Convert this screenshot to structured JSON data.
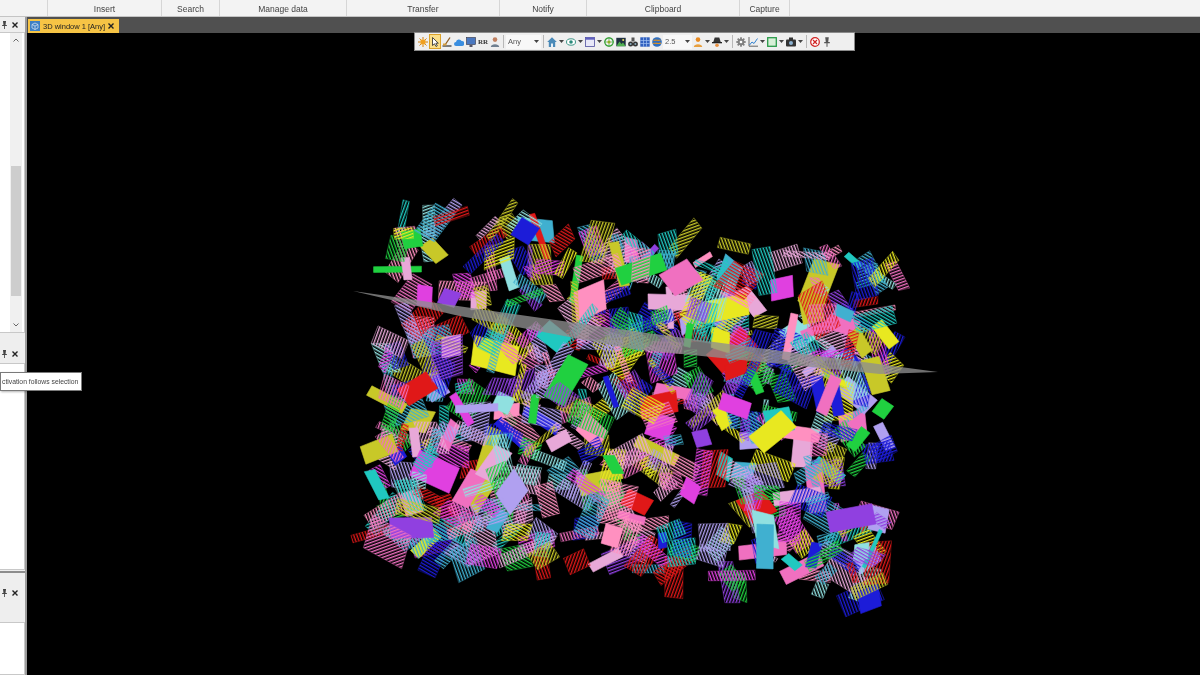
{
  "ribbon": {
    "groups": [
      {
        "label": "Insert"
      },
      {
        "label": "Search"
      },
      {
        "label": "Manage data"
      },
      {
        "label": "Transfer"
      },
      {
        "label": "Notify"
      },
      {
        "label": "Clipboard"
      },
      {
        "label": "Capture"
      }
    ]
  },
  "tabs": [
    {
      "label": "3D window 1 [Any]",
      "selected": true
    }
  ],
  "toolbar": {
    "items": [
      {
        "kind": "button",
        "selected": false
      },
      {
        "kind": "button",
        "selected": true
      },
      {
        "kind": "button",
        "selected": false
      },
      {
        "kind": "button",
        "selected": false
      },
      {
        "kind": "button",
        "selected": false
      },
      {
        "kind": "button",
        "label": "RR",
        "selected": false
      },
      {
        "kind": "button",
        "selected": false
      },
      {
        "kind": "separator"
      },
      {
        "kind": "dropdown",
        "value": "Any"
      },
      {
        "kind": "separator"
      },
      {
        "kind": "split",
        "selected": false
      },
      {
        "kind": "split",
        "selected": false
      },
      {
        "kind": "split",
        "selected": false
      },
      {
        "kind": "button",
        "selected": false
      },
      {
        "kind": "button",
        "selected": false
      },
      {
        "kind": "button",
        "selected": false
      },
      {
        "kind": "button",
        "selected": false
      },
      {
        "kind": "button",
        "selected": false
      },
      {
        "kind": "dropdown",
        "value": "2.5"
      },
      {
        "kind": "split",
        "selected": false
      },
      {
        "kind": "split",
        "selected": false
      },
      {
        "kind": "separator"
      },
      {
        "kind": "button",
        "selected": false
      },
      {
        "kind": "split",
        "selected": false
      },
      {
        "kind": "split",
        "selected": false
      },
      {
        "kind": "split",
        "selected": false
      },
      {
        "kind": "separator"
      },
      {
        "kind": "button",
        "selected": false
      },
      {
        "kind": "button",
        "selected": false
      }
    ]
  },
  "tooltip": {
    "text": "ctivation follows selection"
  }
}
